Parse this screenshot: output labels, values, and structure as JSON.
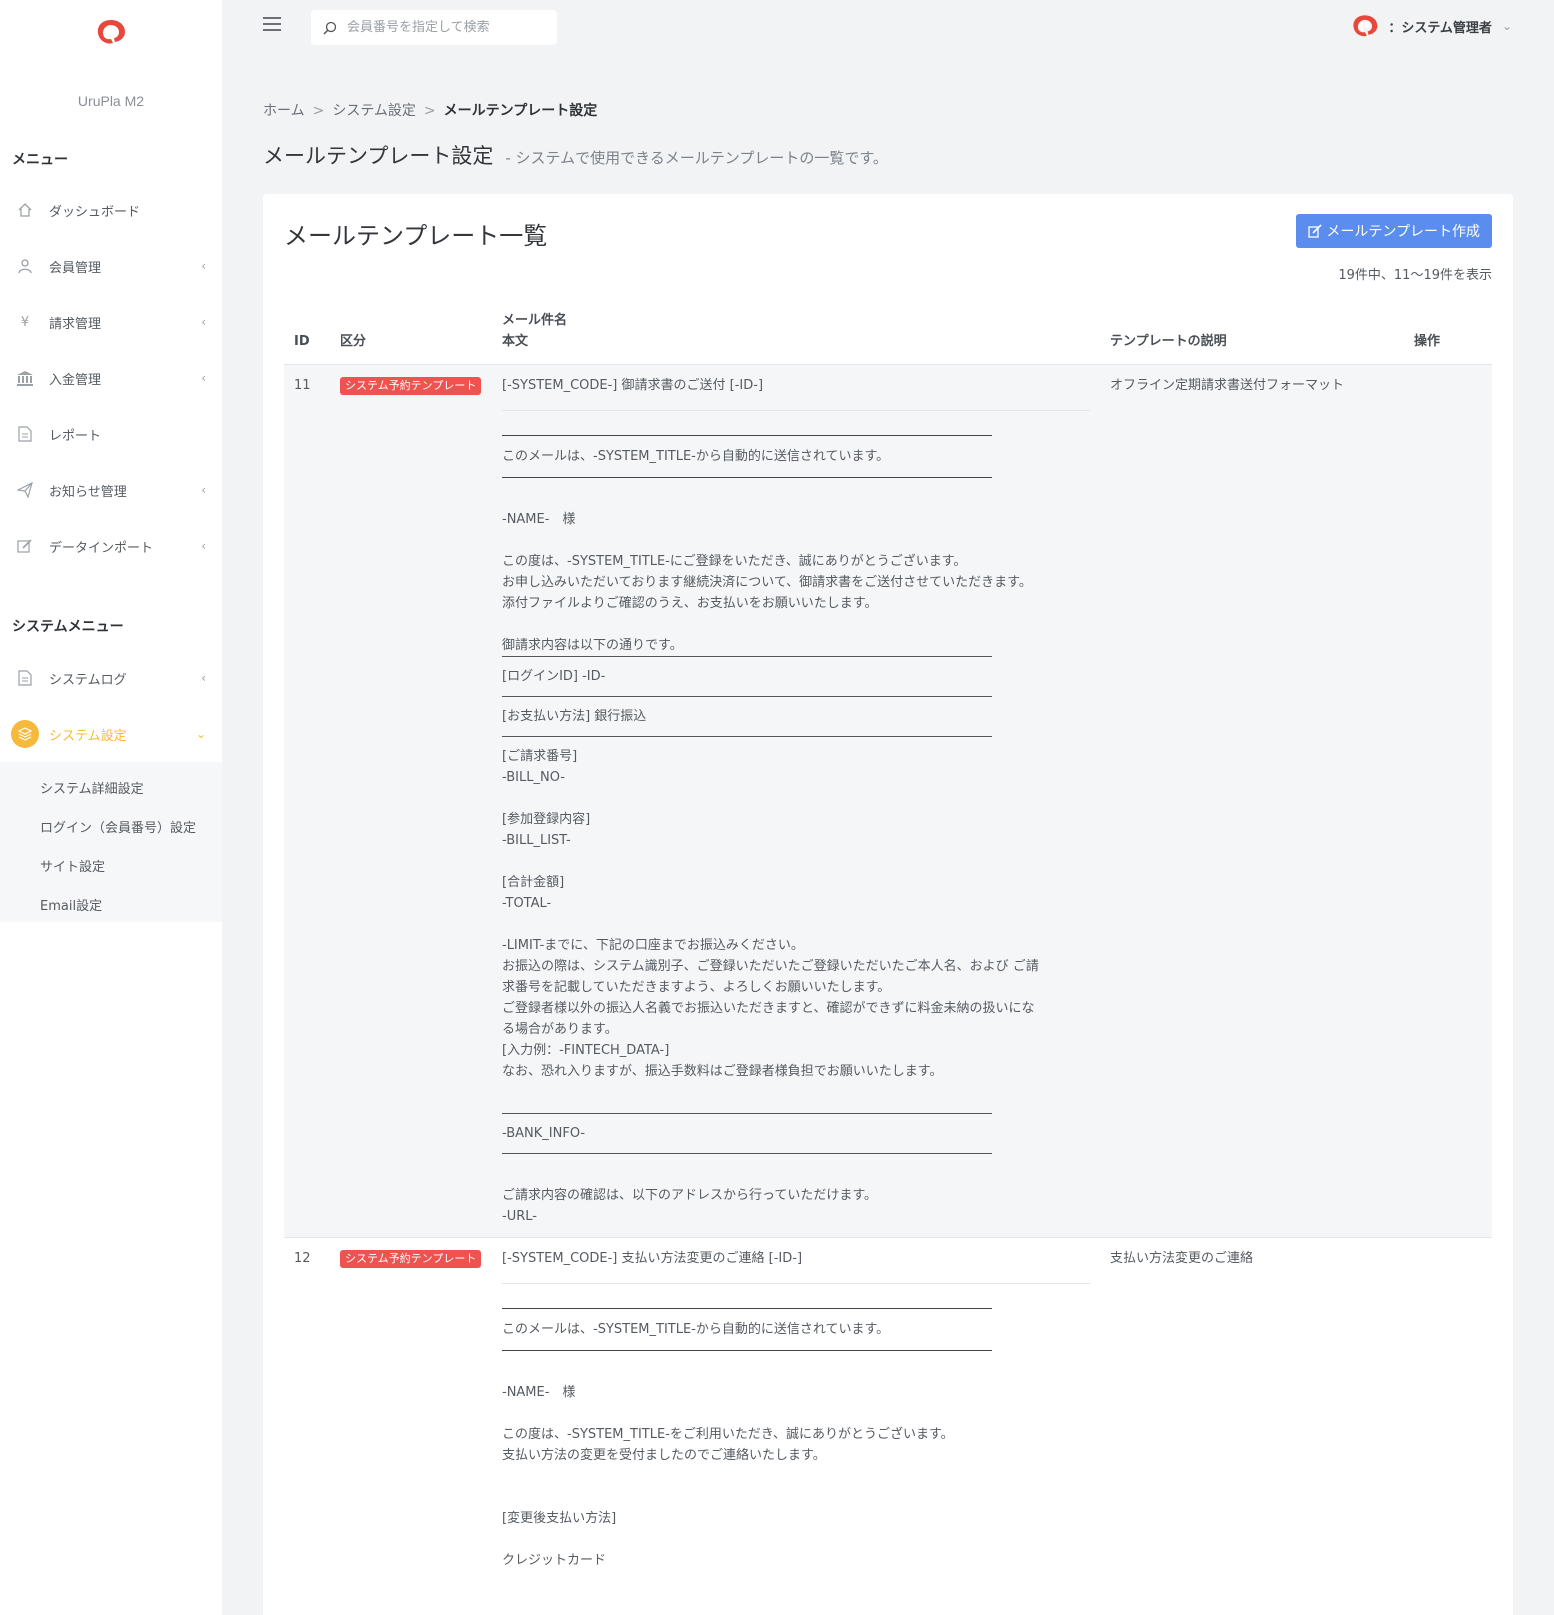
{
  "app": {
    "name": "UruPla M2"
  },
  "header": {
    "search_placeholder": "会員番号を指定して検索",
    "user_label": "：システム管理者"
  },
  "sidebar": {
    "menu_title": "メニュー",
    "items": [
      {
        "label": "ダッシュボード",
        "icon": "home-icon"
      },
      {
        "label": "会員管理",
        "icon": "user-icon"
      },
      {
        "label": "請求管理",
        "icon": "yen-icon"
      },
      {
        "label": "入金管理",
        "icon": "bank-icon"
      },
      {
        "label": "レポート",
        "icon": "document-icon"
      },
      {
        "label": "お知らせ管理",
        "icon": "paper-plane-icon"
      },
      {
        "label": "データインポート",
        "icon": "edit-icon"
      }
    ],
    "system_title": "システムメニュー",
    "system_items": [
      {
        "label": "システムログ",
        "icon": "document-icon"
      },
      {
        "label": "システム設定",
        "icon": "layers-icon"
      }
    ],
    "submenu": [
      "システム詳細設定",
      "ログイン（会員番号）設定",
      "サイト設定",
      "Email設定"
    ]
  },
  "breadcrumb": {
    "home": "ホーム",
    "sep": ">",
    "mid": "システム設定",
    "current": "メールテンプレート設定"
  },
  "page": {
    "title": "メールテンプレート設定",
    "subtitle": "- システムで使用できるメールテンプレートの一覧です。"
  },
  "card": {
    "title": "メールテンプレート一覧",
    "create_label": "メールテンプレート作成",
    "count_text": "19件中、11〜19件を表示"
  },
  "table": {
    "headers": {
      "id": "ID",
      "kind": "区分",
      "subject": "メール件名",
      "body": "本文",
      "desc": "テンプレートの説明",
      "ops": "操作"
    },
    "rows": [
      {
        "id": "11",
        "badge": "システム予約テンプレート",
        "subject": "[-SYSTEM_CODE-] 御請求書のご送付 [-ID-]",
        "desc": "オフライン定期請求書送付フォーマット",
        "body": [
          "このメールは、-SYSTEM_TITLE-から自動的に送信されています。",
          "-NAME-　様",
          "この度は、-SYSTEM_TITLE-にご登録をいただき、誠にありがとうございます。",
          "お申し込みいただいております継続決済について、御請求書をご送付させていただきます。",
          "添付ファイルよりご確認のうえ、お支払いをお願いいたします。",
          "御請求内容は以下の通りです。",
          "[ログインID] -ID-",
          "[お支払い方法] 銀行振込",
          "[ご請求番号]",
          "-BILL_NO-",
          "[参加登録内容]",
          "-BILL_LIST-",
          "[合計金額]",
          "-TOTAL-",
          "-LIMIT-までに、下記の口座までお振込みください。",
          "お振込の際は、システム識別子、ご登録いただいたご登録いただいたご本人名、および ご請",
          "求番号を記載していただきますよう、よろしくお願いいたします。",
          "ご登録者様以外の振込人名義でお振込いただきますと、確認ができずに料金未納の扱いにな",
          "る場合があります。",
          "[入力例：-FINTECH_DATA-]",
          "なお、恐れ入りますが、振込手数料はご登録者様負担でお願いいたします。",
          "-BANK_INFO-",
          "ご請求内容の確認は、以下のアドレスから行っていただけます。",
          "-URL-"
        ]
      },
      {
        "id": "12",
        "badge": "システム予約テンプレート",
        "subject": "[-SYSTEM_CODE-] 支払い方法変更のご連絡 [-ID-]",
        "desc": "支払い方法変更のご連絡",
        "body": [
          "このメールは、-SYSTEM_TITLE-から自動的に送信されています。",
          "-NAME-　様",
          "この度は、-SYSTEM_TITLE-をご利用いただき、誠にありがとうございます。",
          "支払い方法の変更を受付ましたのでご連絡いたします。",
          "[変更後支払い方法]",
          "クレジットカード"
        ]
      }
    ]
  },
  "colors": {
    "accent": "#5b8def",
    "active": "#f6b93b",
    "badge": "#ef5350",
    "brand": "#e8483b"
  }
}
